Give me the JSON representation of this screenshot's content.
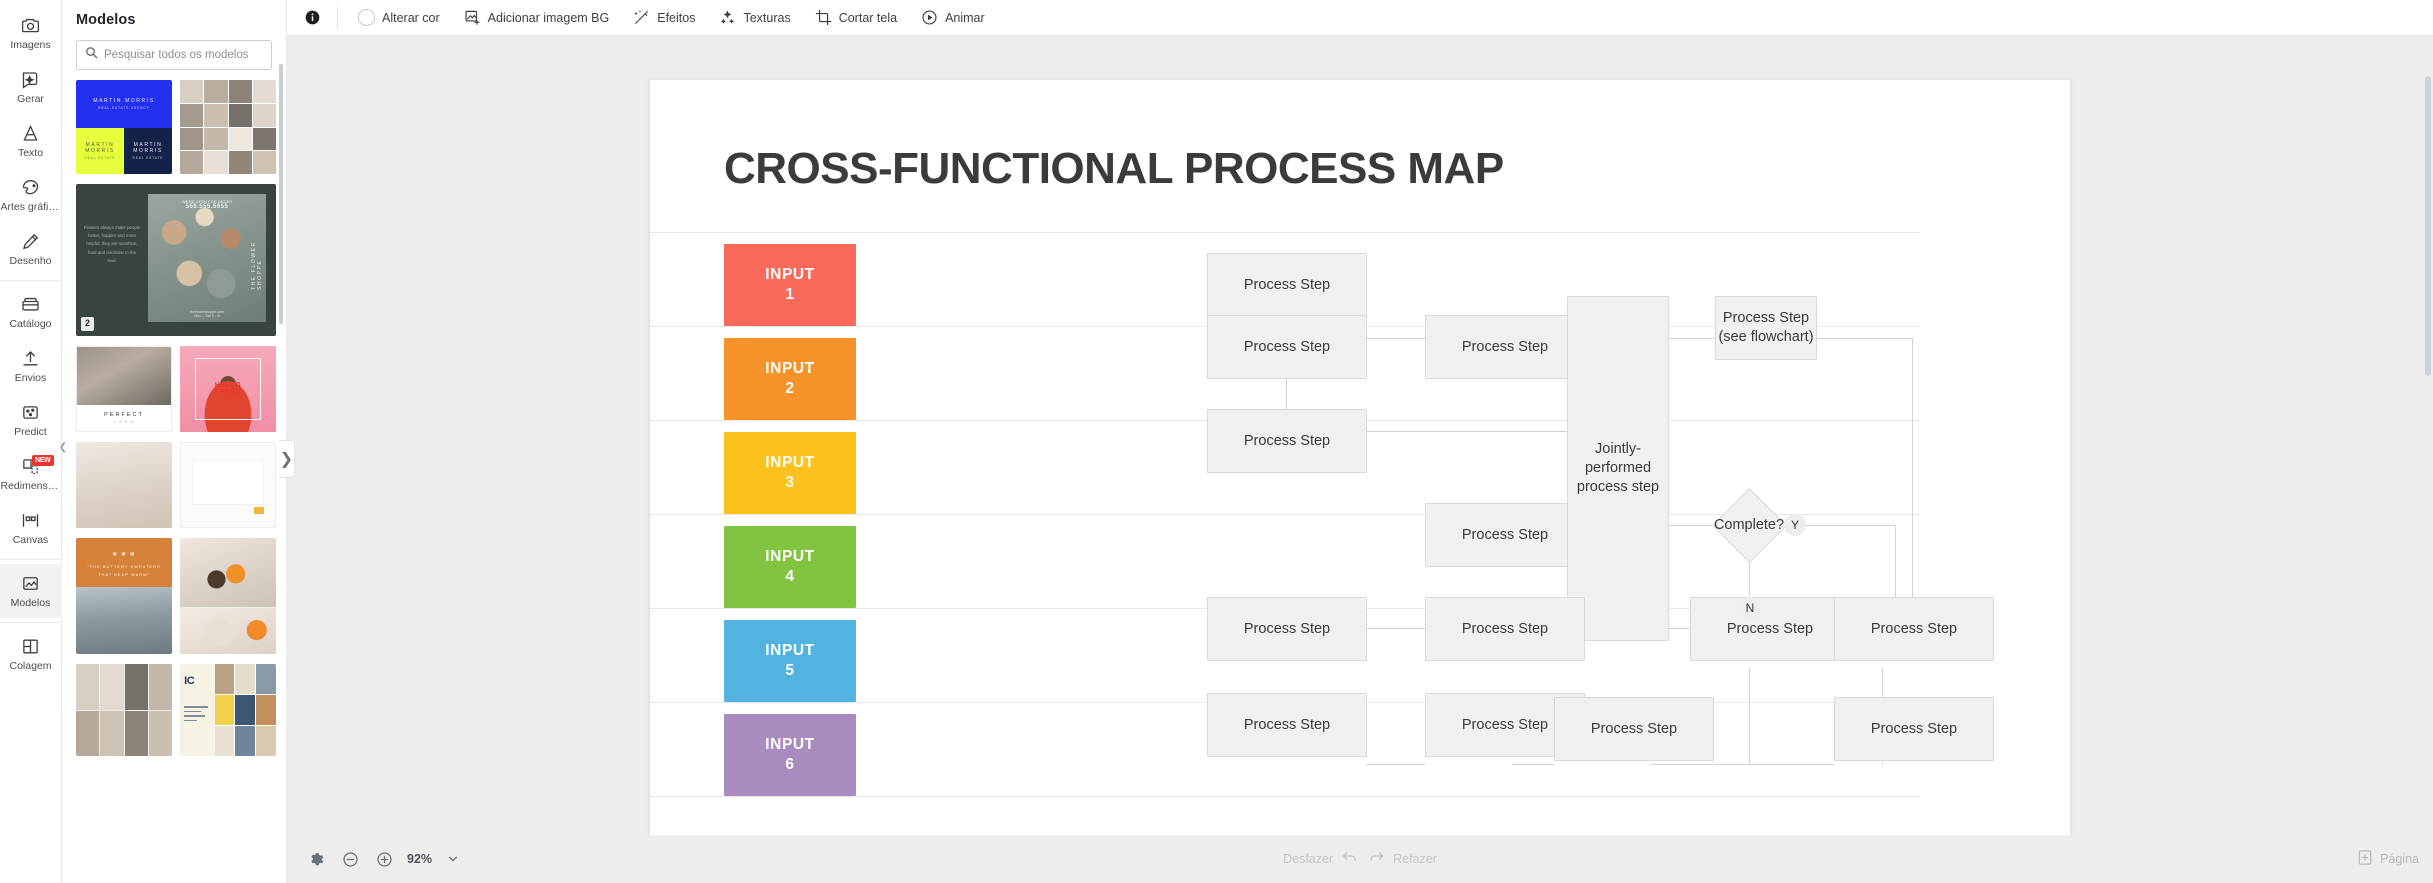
{
  "rail": {
    "items": [
      {
        "label": "Imagens",
        "icon": "camera-icon",
        "active": false,
        "badge": null
      },
      {
        "label": "Gerar",
        "icon": "generate-ai-icon",
        "active": false,
        "badge": null
      },
      {
        "label": "Texto",
        "icon": "text-icon",
        "active": false,
        "badge": null
      },
      {
        "label": "Artes gráfic...",
        "icon": "graphics-icon",
        "active": false,
        "badge": null
      },
      {
        "label": "Desenho",
        "icon": "draw-pencil-icon",
        "active": false,
        "badge": null
      },
      {
        "label": "Catálogo",
        "icon": "catalog-icon",
        "active": false,
        "badge": null
      },
      {
        "label": "Envios",
        "icon": "upload-icon",
        "active": false,
        "badge": null
      },
      {
        "label": "Predict",
        "icon": "predict-icon",
        "active": false,
        "badge": null
      },
      {
        "label": "Redimensio...",
        "icon": "resize-icon",
        "active": false,
        "badge": "NEW"
      },
      {
        "label": "Canvas",
        "icon": "canvas-icon",
        "active": false,
        "badge": null
      },
      {
        "label": "Modelos",
        "icon": "templates-icon",
        "active": true,
        "badge": null
      },
      {
        "label": "Colagem",
        "icon": "collage-icon",
        "active": false,
        "badge": null
      }
    ]
  },
  "panel": {
    "title": "Modelos",
    "search_placeholder": "Pesquisar todos os modelos",
    "search_value": "",
    "thumbnails": [
      {
        "name": "martin-morris-brand-kit",
        "badge": null
      },
      {
        "name": "photo-grid-collage",
        "badge": null
      },
      {
        "name": "the-flower-shoppe-spread",
        "badge": "2"
      },
      {
        "name": "perfect-look-portrait",
        "badge": null
      },
      {
        "name": "hello-fresh-pink-portrait",
        "badge": null
      },
      {
        "name": "beige-interior-mood",
        "badge": null
      },
      {
        "name": "minimal-white-layout",
        "badge": null
      },
      {
        "name": "autumn-fashion-cover",
        "badge": null
      },
      {
        "name": "food-photography-stack",
        "badge": null
      },
      {
        "name": "lifestyle-photo-mosaic",
        "badge": null
      },
      {
        "name": "ic-brand-guidelines",
        "badge": null
      }
    ]
  },
  "toolbar": {
    "info_icon": "info-icon",
    "items": [
      {
        "label": "Alterar cor",
        "icon": "color-circle-icon"
      },
      {
        "label": "Adicionar imagem BG",
        "icon": "add-image-icon"
      },
      {
        "label": "Efeitos",
        "icon": "effects-sparkle-icon"
      },
      {
        "label": "Texturas",
        "icon": "textures-icon"
      },
      {
        "label": "Cortar tela",
        "icon": "crop-icon"
      },
      {
        "label": "Animar",
        "icon": "animate-play-icon"
      }
    ]
  },
  "bottombar": {
    "settings_icon": "gear-icon",
    "zoom_out_icon": "zoom-out-icon",
    "zoom_in_icon": "zoom-in-icon",
    "zoom_level": "92%",
    "zoom_caret_icon": "chevron-down-icon",
    "undo_label": "Desfazer",
    "undo_icon": "undo-arrow-icon",
    "redo_label": "Refazer",
    "redo_icon": "redo-arrow-icon",
    "add_page_label": "Página",
    "add_page_icon": "add-page-icon"
  },
  "chart_data": {
    "type": "diagram",
    "diagram_kind": "cross-functional-flowchart",
    "title": "CROSS-FUNCTIONAL PROCESS MAP",
    "lanes": [
      {
        "label_line1": "INPUT",
        "label_line2": "1",
        "color": "#fa6a5a"
      },
      {
        "label_line1": "INPUT",
        "label_line2": "2",
        "color": "#f59229"
      },
      {
        "label_line1": "INPUT",
        "label_line2": "3",
        "color": "#fcc11b"
      },
      {
        "label_line1": "INPUT",
        "label_line2": "4",
        "color": "#82c341"
      },
      {
        "label_line1": "INPUT",
        "label_line2": "5",
        "color": "#52b3e0"
      },
      {
        "label_line1": "INPUT",
        "label_line2": "6",
        "color": "#a98cbd"
      }
    ],
    "nodes": [
      {
        "id": "n1",
        "lane": 1,
        "col": 1,
        "label": "Process Step",
        "shape": "rect"
      },
      {
        "id": "n2",
        "lane": 2,
        "col": 1,
        "label": "Process Step",
        "shape": "rect"
      },
      {
        "id": "n3",
        "lane": 2,
        "col": 2,
        "label": "Process Step",
        "shape": "rect"
      },
      {
        "id": "n4",
        "lane": 3,
        "col": 1,
        "label": "Process Step",
        "shape": "rect"
      },
      {
        "id": "n5",
        "lane": 4,
        "col": 2,
        "label": "Process Step",
        "shape": "rect"
      },
      {
        "id": "n6",
        "lane": "2-4",
        "col": 3,
        "label": "Jointly-performed process step",
        "shape": "tall-rect"
      },
      {
        "id": "n7",
        "lane": 2,
        "col": 4,
        "label": "Process Step (see flowchart)",
        "shape": "rect"
      },
      {
        "id": "n8",
        "lane": 4,
        "col": 4,
        "label": "Complete?",
        "shape": "diamond"
      },
      {
        "id": "n9",
        "lane": 5,
        "col": 1,
        "label": "Process Step",
        "shape": "rect"
      },
      {
        "id": "n10",
        "lane": 5,
        "col": 2,
        "label": "Process Step",
        "shape": "rect"
      },
      {
        "id": "n11",
        "lane": 5,
        "col": 4,
        "label": "Process Step",
        "shape": "rect"
      },
      {
        "id": "n12",
        "lane": 5,
        "col": 5,
        "label": "Process Step",
        "shape": "rect"
      },
      {
        "id": "n13",
        "lane": 6,
        "col": 1,
        "label": "Process Step",
        "shape": "rect"
      },
      {
        "id": "n14",
        "lane": 6,
        "col": 2,
        "label": "Process Step",
        "shape": "rect"
      },
      {
        "id": "n15",
        "lane": 6,
        "col": 3,
        "label": "Process Step",
        "shape": "rect"
      },
      {
        "id": "n16",
        "lane": 6,
        "col": 5,
        "label": "Process Step",
        "shape": "rect"
      }
    ],
    "edge_labels": [
      {
        "id": "yes",
        "label": "Y"
      },
      {
        "id": "no",
        "label": "N"
      }
    ]
  }
}
